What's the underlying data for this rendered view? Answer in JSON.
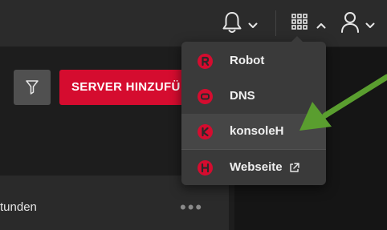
{
  "header": {
    "icons": [
      "bell-icon",
      "chevron-down-icon",
      "apps-grid-icon",
      "chevron-up-icon",
      "user-icon",
      "chevron-down-icon"
    ]
  },
  "toolbar": {
    "filter_icon": "filter-icon",
    "server_button_label": "SERVER HINZUFÜ"
  },
  "list": {
    "row_text": "tunden",
    "row_menu_icon": "more-dots-icon"
  },
  "app_menu": {
    "items": [
      {
        "label": "Robot",
        "icon": "robot-logo-icon"
      },
      {
        "label": "DNS",
        "icon": "dns-logo-icon"
      },
      {
        "label": "konsoleH",
        "icon": "konsoleh-logo-icon"
      },
      {
        "label": "Webseite",
        "icon": "website-logo-icon",
        "external": true
      }
    ]
  },
  "colors": {
    "brand_red": "#d50c2f",
    "arrow_green": "#5a9e2f",
    "menu_bg": "#3a3a3a"
  }
}
